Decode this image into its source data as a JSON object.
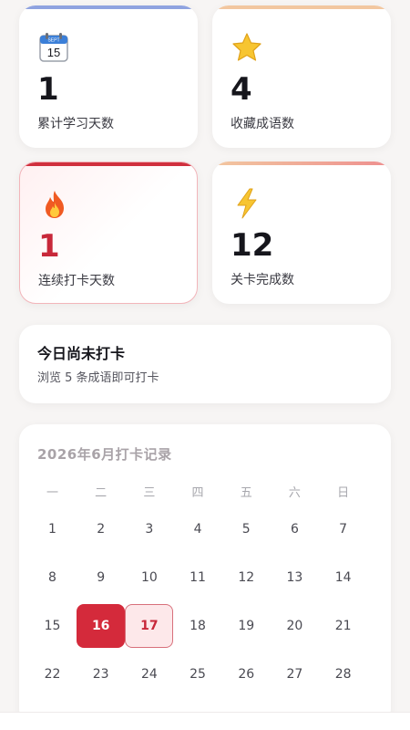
{
  "stats": [
    {
      "id": "days",
      "icon": "calendar-icon",
      "value": "1",
      "label": "累计学习天数",
      "accent": "#8fa3e0"
    },
    {
      "id": "fav",
      "icon": "star-icon",
      "value": "4",
      "label": "收藏成语数",
      "accent": "#f2c7a0"
    },
    {
      "id": "streak",
      "icon": "fire-icon",
      "value": "1",
      "label": "连续打卡天数",
      "accent": "#d0303e"
    },
    {
      "id": "levels",
      "icon": "lightning-icon",
      "value": "12",
      "label": "关卡完成数",
      "accent": "#f0a890"
    }
  ],
  "checkin": {
    "title": "今日尚未打卡",
    "subtitle": "浏览 5 条成语即可打卡"
  },
  "calendar": {
    "title": "2026年6月打卡记录",
    "weekdays": [
      "一",
      "二",
      "三",
      "四",
      "五",
      "六",
      "日"
    ],
    "weeks": [
      [
        "1",
        "2",
        "3",
        "4",
        "5",
        "6",
        "7"
      ],
      [
        "8",
        "9",
        "10",
        "11",
        "12",
        "13",
        "14"
      ],
      [
        "15",
        "16",
        "17",
        "18",
        "19",
        "20",
        "21"
      ],
      [
        "22",
        "23",
        "24",
        "25",
        "26",
        "27",
        "28"
      ]
    ],
    "checked_days": [
      "16"
    ],
    "today": "17"
  },
  "colors": {
    "checked": "#d42a3b",
    "today_bg": "#fde8ea",
    "streak_value": "#c8283a"
  }
}
